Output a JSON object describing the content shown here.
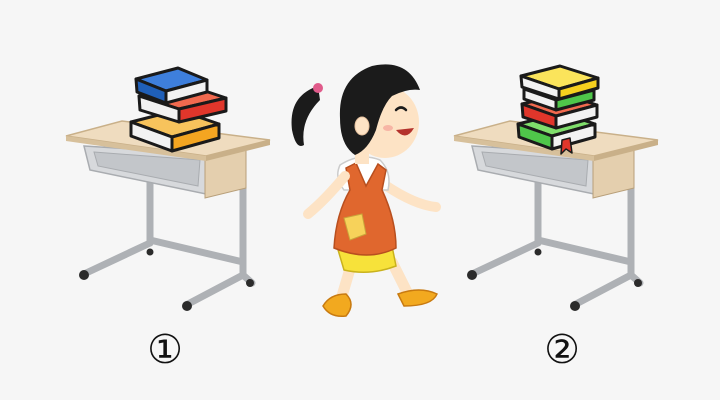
{
  "labels": {
    "desk_1": "①",
    "desk_2": "②"
  },
  "colors": {
    "background": "#f6f6f6",
    "desk_top": "#efdcbf",
    "desk_edge": "#c9b089",
    "desk_frame": "#b9bcc0",
    "desk_drawer": "#d7d9dc",
    "leg_metal": "#c8cbcf",
    "wheel": "#2b2b2b",
    "book_blue": "#1f5fb8",
    "book_red": "#e0362b",
    "book_orange": "#f4a521",
    "book_yellow": "#f6d01e",
    "book_green": "#4fc64a",
    "girl_hair": "#1b1b1b",
    "girl_skin": "#fde3c5",
    "girl_dress": "#e0672e",
    "girl_shorts": "#f7e23a",
    "girl_shoes": "#f2a91f"
  }
}
